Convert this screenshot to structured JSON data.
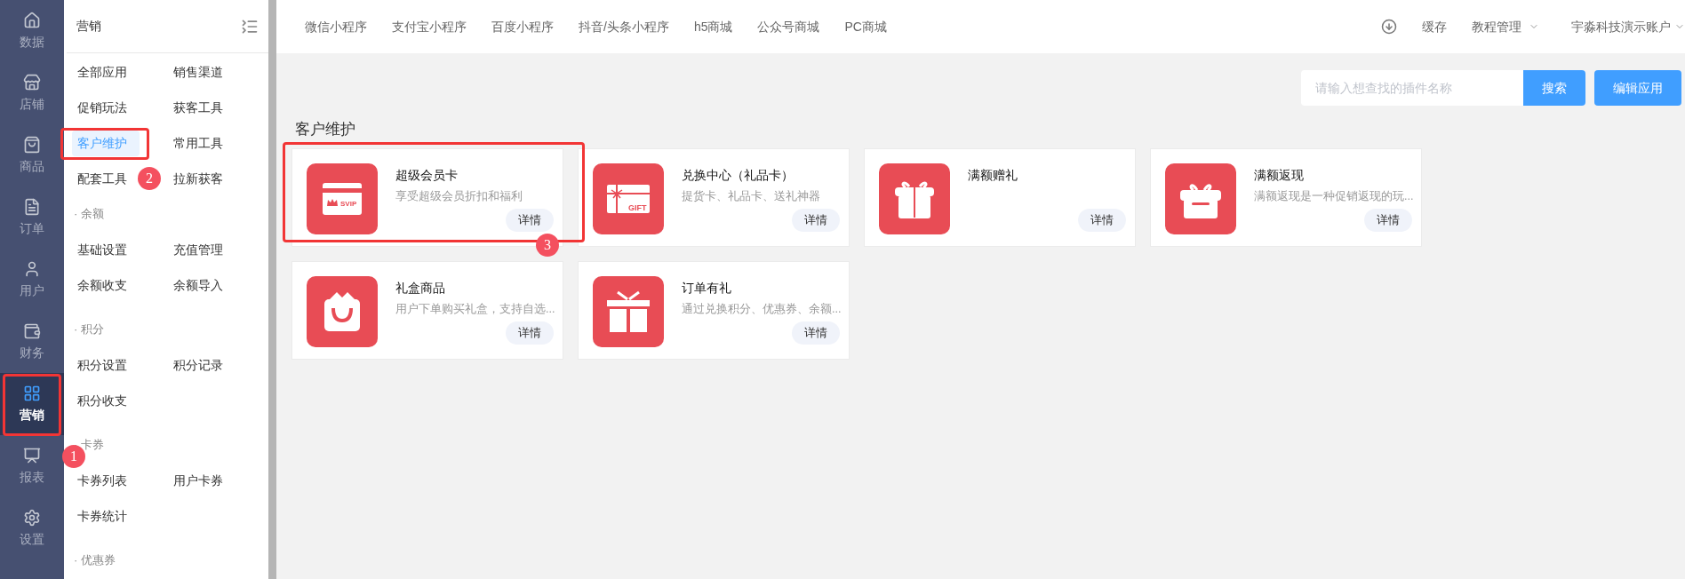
{
  "nav": [
    {
      "label": "数据",
      "selected": false
    },
    {
      "label": "店铺",
      "selected": false
    },
    {
      "label": "商品",
      "selected": false
    },
    {
      "label": "订单",
      "selected": false
    },
    {
      "label": "用户",
      "selected": false
    },
    {
      "label": "财务",
      "selected": false
    },
    {
      "label": "营销",
      "selected": true
    },
    {
      "label": "报表",
      "selected": false
    },
    {
      "label": "设置",
      "selected": false
    }
  ],
  "submenu": {
    "title": "营销",
    "groups": [
      {
        "items": [
          {
            "label": "全部应用",
            "selected": false
          },
          {
            "label": "销售渠道",
            "selected": false
          },
          {
            "label": "促销玩法",
            "selected": false
          },
          {
            "label": "获客工具",
            "selected": false
          },
          {
            "label": "客户维护",
            "selected": true
          },
          {
            "label": "常用工具",
            "selected": false
          },
          {
            "label": "配套工具",
            "selected": false
          },
          {
            "label": "拉新获客",
            "selected": false
          }
        ]
      },
      {
        "title": "· 余额",
        "items": [
          {
            "label": "基础设置",
            "selected": false
          },
          {
            "label": "充值管理",
            "selected": false
          },
          {
            "label": "余额收支",
            "selected": false
          },
          {
            "label": "余额导入",
            "selected": false
          }
        ]
      },
      {
        "title": "· 积分",
        "items": [
          {
            "label": "积分设置",
            "selected": false
          },
          {
            "label": "积分记录",
            "selected": false
          },
          {
            "label": "积分收支",
            "selected": false
          }
        ]
      },
      {
        "title": "· 卡券",
        "items": [
          {
            "label": "卡券列表",
            "selected": false
          },
          {
            "label": "用户卡券",
            "selected": false
          },
          {
            "label": "卡券统计",
            "selected": false
          }
        ]
      },
      {
        "title": "· 优惠券"
      }
    ]
  },
  "topbar": {
    "links": [
      "微信小程序",
      "支付宝小程序",
      "百度小程序",
      "抖音/头条小程序",
      "h5商城",
      "公众号商城",
      "PC商城"
    ],
    "cache": "缓存",
    "tutorial": "教程管理",
    "account": "宇淼科技演示账户"
  },
  "search": {
    "placeholder": "请输入想查找的插件名称",
    "button": "搜索"
  },
  "edit_button": "编辑应用",
  "section_title": "客户维护",
  "cards": [
    {
      "kind": "svip",
      "icon_text": "SVIP",
      "title": "超级会员卡",
      "description": "享受超级会员折扣和福利",
      "button": "详情"
    },
    {
      "kind": "giftcard",
      "icon_text": "GIFT",
      "title": "兑换中心（礼品卡）",
      "description": "提货卡、礼品卡、送礼神器",
      "button": "详情"
    },
    {
      "kind": "giftbox",
      "title": "满额赠礼",
      "button": "详情"
    },
    {
      "kind": "giftlid",
      "title": "满额返现",
      "description": "满额返现是一种促销返现的玩...",
      "button": "详情"
    },
    {
      "kind": "bag",
      "title": "礼盒商品",
      "description": "用户下单购买礼盒，支持自选...",
      "button": "详情"
    },
    {
      "kind": "gift",
      "title": "订单有礼",
      "description": "通过兑换积分、优惠券、余额...",
      "button": "详情"
    }
  ],
  "annotations": [
    {
      "label": "1"
    },
    {
      "label": "2"
    },
    {
      "label": "3"
    }
  ]
}
